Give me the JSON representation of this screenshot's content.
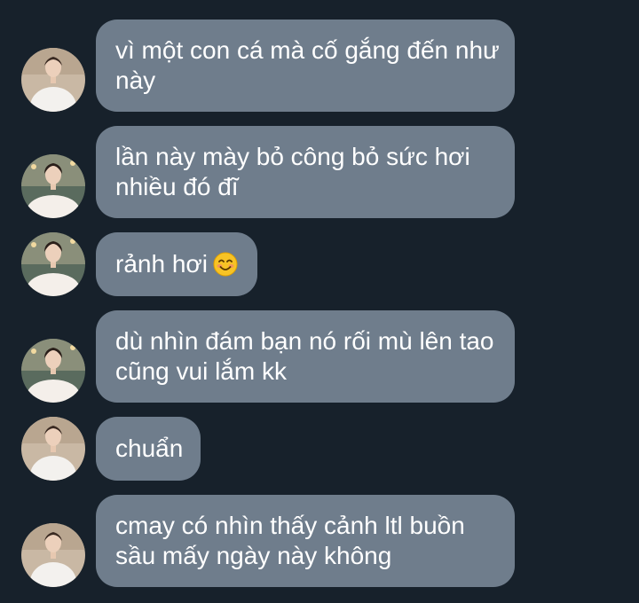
{
  "colors": {
    "background": "#17212b",
    "bubble": "#6f7d8c",
    "text": "#ffffff"
  },
  "messages": [
    {
      "lines": [
        "vì một con cá mà cố gắng đến như",
        "này"
      ],
      "avatar": "profile-photo-white-shirt"
    },
    {
      "lines": [
        "lần này mày bỏ công bỏ sức hơi",
        "nhiều đó đĩ"
      ],
      "avatar": "profile-photo-white-dress"
    },
    {
      "lines": [
        "rảnh hơi"
      ],
      "emoji": "smiling-face-emoji",
      "avatar": "profile-photo-white-dress"
    },
    {
      "lines": [
        "dù nhìn đám bạn nó rối mù lên tao",
        "cũng vui lắm kk"
      ],
      "avatar": "profile-photo-white-dress"
    },
    {
      "lines": [
        "chuẩn"
      ],
      "avatar": "profile-photo-white-shirt"
    },
    {
      "lines": [
        "cmay có nhìn thấy cảnh ltl buồn",
        "sầu mấy ngày này không"
      ],
      "avatar": "profile-photo-white-shirt"
    }
  ]
}
